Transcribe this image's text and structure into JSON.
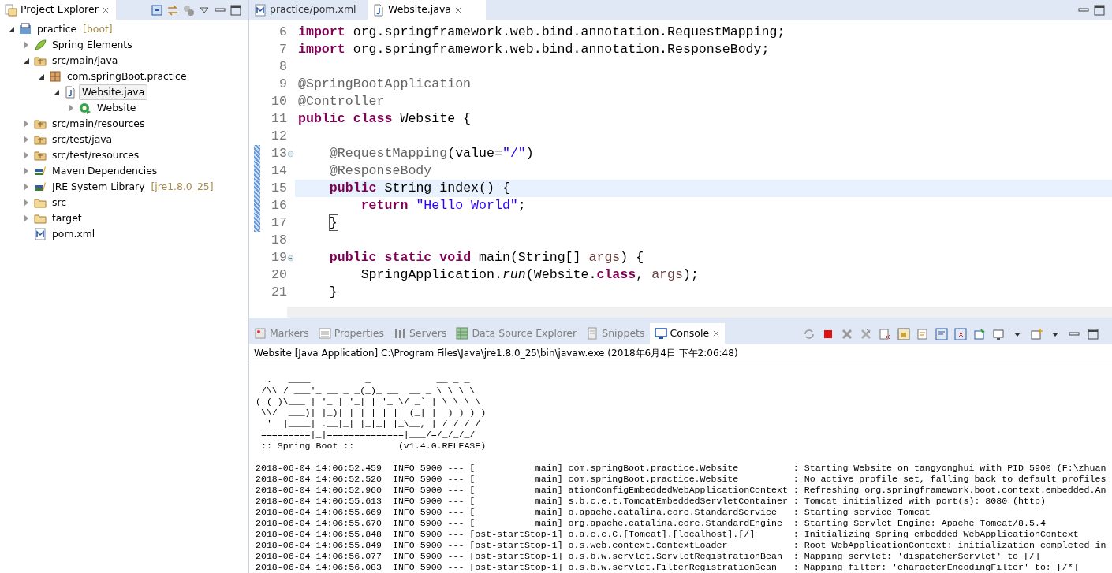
{
  "explorer": {
    "title": "Project Explorer",
    "tree": [
      {
        "label": "practice",
        "decoration": "[boot]",
        "kind": "project",
        "expanded": true,
        "selected": false,
        "children": [
          {
            "label": "Spring Elements",
            "kind": "leaf",
            "expanded": false,
            "selected": false
          },
          {
            "label": "src/main/java",
            "kind": "source",
            "expanded": true,
            "selected": false,
            "children": [
              {
                "label": "com.springBoot.practice",
                "kind": "package",
                "expanded": true,
                "selected": false,
                "children": [
                  {
                    "label": "Website.java",
                    "kind": "java",
                    "expanded": true,
                    "selected": true,
                    "children": [
                      {
                        "label": "Website",
                        "kind": "class",
                        "expanded": false,
                        "selected": false
                      }
                    ]
                  }
                ]
              }
            ]
          },
          {
            "label": "src/main/resources",
            "kind": "source",
            "expanded": false,
            "selected": false
          },
          {
            "label": "src/test/java",
            "kind": "source",
            "expanded": false,
            "selected": false
          },
          {
            "label": "src/test/resources",
            "kind": "source",
            "expanded": false,
            "selected": false
          },
          {
            "label": "Maven Dependencies",
            "kind": "library",
            "expanded": false,
            "selected": false
          },
          {
            "label": "JRE System Library",
            "decoration": "[jre1.8.0_25]",
            "kind": "library",
            "expanded": false,
            "selected": false
          },
          {
            "label": "src",
            "kind": "folder",
            "expanded": false,
            "selected": false
          },
          {
            "label": "target",
            "kind": "folder",
            "expanded": false,
            "selected": false
          },
          {
            "label": "pom.xml",
            "kind": "pom",
            "selected": false
          }
        ]
      }
    ]
  },
  "editor": {
    "tabs": [
      {
        "label": "practice/pom.xml",
        "kind": "pom",
        "selected": false
      },
      {
        "label": "Website.java",
        "kind": "java",
        "selected": true
      }
    ],
    "lines": [
      {
        "number": "6",
        "changed": false,
        "current": false,
        "fold": false,
        "tokens": [
          {
            "kind": "keyword",
            "text": "import"
          },
          {
            "kind": "plain",
            "text": " org.springframework.web.bind.annotation.RequestMapping;"
          }
        ]
      },
      {
        "number": "7",
        "changed": false,
        "current": false,
        "fold": false,
        "tokens": [
          {
            "kind": "keyword",
            "text": "import"
          },
          {
            "kind": "plain",
            "text": " org.springframework.web.bind.annotation.ResponseBody;"
          }
        ]
      },
      {
        "number": "8",
        "changed": false,
        "current": false,
        "fold": false
      },
      {
        "number": "9",
        "changed": false,
        "current": false,
        "fold": false,
        "tokens": [
          {
            "kind": "annotation",
            "text": "@SpringBootApplication"
          }
        ]
      },
      {
        "number": "10",
        "changed": false,
        "current": false,
        "fold": false,
        "tokens": [
          {
            "kind": "annotation",
            "text": "@Controller"
          }
        ]
      },
      {
        "number": "11",
        "changed": false,
        "current": false,
        "fold": false,
        "tokens": [
          {
            "kind": "keyword",
            "text": "public"
          },
          {
            "kind": "keyword",
            "text": " class"
          },
          {
            "kind": "plain",
            "text": " Website {"
          }
        ]
      },
      {
        "number": "12",
        "changed": false,
        "current": false,
        "fold": false
      },
      {
        "number": "13",
        "changed": true,
        "current": false,
        "fold": true,
        "tokens": [
          {
            "kind": "annotation",
            "text": "    @RequestMapping"
          },
          {
            "kind": "plain",
            "text": "(value="
          },
          {
            "kind": "string",
            "text": "\"/\""
          },
          {
            "kind": "plain",
            "text": ")"
          }
        ]
      },
      {
        "number": "14",
        "changed": true,
        "current": false,
        "fold": false,
        "tokens": [
          {
            "kind": "annotation",
            "text": "    @ResponseBody"
          }
        ]
      },
      {
        "number": "15",
        "changed": true,
        "current": true,
        "fold": false,
        "tokens": [
          {
            "kind": "keyword",
            "text": "    public"
          },
          {
            "kind": "plain",
            "text": " String index() {"
          }
        ]
      },
      {
        "number": "16",
        "changed": true,
        "current": false,
        "fold": false,
        "tokens": [
          {
            "kind": "keyword",
            "text": "        return"
          },
          {
            "kind": "string",
            "text": " \"Hello World\""
          },
          {
            "kind": "plain",
            "text": ";"
          }
        ]
      },
      {
        "number": "17",
        "changed": true,
        "current": false,
        "fold": false,
        "tokens": [
          {
            "kind": "matched",
            "text": "    }"
          }
        ]
      },
      {
        "number": "18",
        "changed": false,
        "current": false,
        "fold": false
      },
      {
        "number": "19",
        "changed": false,
        "current": false,
        "fold": true,
        "tokens": [
          {
            "kind": "keyword",
            "text": "    public"
          },
          {
            "kind": "keyword",
            "text": " static"
          },
          {
            "kind": "keyword",
            "text": " void"
          },
          {
            "kind": "plain",
            "text": " main(String[] "
          },
          {
            "kind": "param",
            "text": "args"
          },
          {
            "kind": "plain",
            "text": ") {"
          }
        ]
      },
      {
        "number": "20",
        "changed": false,
        "current": false,
        "fold": false,
        "tokens": [
          {
            "kind": "plain",
            "text": "        SpringApplication."
          },
          {
            "kind": "static",
            "text": "run"
          },
          {
            "kind": "plain",
            "text": "(Website."
          },
          {
            "kind": "keyword",
            "text": "class"
          },
          {
            "kind": "plain",
            "text": ", "
          },
          {
            "kind": "param",
            "text": "args"
          },
          {
            "kind": "plain",
            "text": ");"
          }
        ]
      },
      {
        "number": "21",
        "changed": false,
        "current": false,
        "fold": false,
        "tokens": [
          {
            "kind": "plain",
            "text": "    }"
          }
        ]
      }
    ]
  },
  "console": {
    "tabs": [
      {
        "label": "Markers",
        "kind": "markers",
        "selected": false
      },
      {
        "label": "Properties",
        "kind": "properties",
        "selected": false
      },
      {
        "label": "Servers",
        "kind": "servers",
        "selected": false
      },
      {
        "label": "Data Source Explorer",
        "kind": "datasource",
        "selected": false
      },
      {
        "label": "Snippets",
        "kind": "snippets",
        "selected": false
      },
      {
        "label": "Console",
        "kind": "console",
        "selected": true
      }
    ],
    "process": "Website [Java Application] C:\\Program Files\\Java\\jre1.8.0_25\\bin\\javaw.exe (2018年6月4日 下午2:06:48)",
    "banner": [
      "  .   ____          _            __ _ _",
      " /\\\\ / ___'_ __ _ _(_)_ __  __ _ \\ \\ \\ \\",
      "( ( )\\___ | '_ | '_| | '_ \\/ _` | \\ \\ \\ \\",
      " \\\\/  ___)| |_)| | | | | || (_| |  ) ) ) )",
      "  '  |____| .__|_| |_|_| |_\\__, | / / / /",
      " =========|_|==============|___/=/_/_/_/",
      " :: Spring Boot ::        (v1.4.0.RELEASE)"
    ],
    "log": [
      "2018-06-04 14:06:52.459  INFO 5900 --- [           main] com.springBoot.practice.Website          : Starting Website on tangyonghui with PID 5900 (F:\\zhuan",
      "2018-06-04 14:06:52.520  INFO 5900 --- [           main] com.springBoot.practice.Website          : No active profile set, falling back to default profiles",
      "2018-06-04 14:06:52.960  INFO 5900 --- [           main] ationConfigEmbeddedWebApplicationContext : Refreshing org.springframework.boot.context.embedded.An",
      "2018-06-04 14:06:55.613  INFO 5900 --- [           main] s.b.c.e.t.TomcatEmbeddedServletContainer : Tomcat initialized with port(s): 8080 (http)",
      "2018-06-04 14:06:55.669  INFO 5900 --- [           main] o.apache.catalina.core.StandardService   : Starting service Tomcat",
      "2018-06-04 14:06:55.670  INFO 5900 --- [           main] org.apache.catalina.core.StandardEngine  : Starting Servlet Engine: Apache Tomcat/8.5.4",
      "2018-06-04 14:06:55.848  INFO 5900 --- [ost-startStop-1] o.a.c.c.C.[Tomcat].[localhost].[/]       : Initializing Spring embedded WebApplicationContext",
      "2018-06-04 14:06:55.849  INFO 5900 --- [ost-startStop-1] o.s.web.context.ContextLoader            : Root WebApplicationContext: initialization completed in",
      "2018-06-04 14:06:56.077  INFO 5900 --- [ost-startStop-1] o.s.b.w.servlet.ServletRegistrationBean  : Mapping servlet: 'dispatcherServlet' to [/]",
      "2018-06-04 14:06:56.083  INFO 5900 --- [ost-startStop-1] o.s.b.w.servlet.FilterRegistrationBean   : Mapping filter: 'characterEncodingFilter' to: [/*]"
    ]
  }
}
